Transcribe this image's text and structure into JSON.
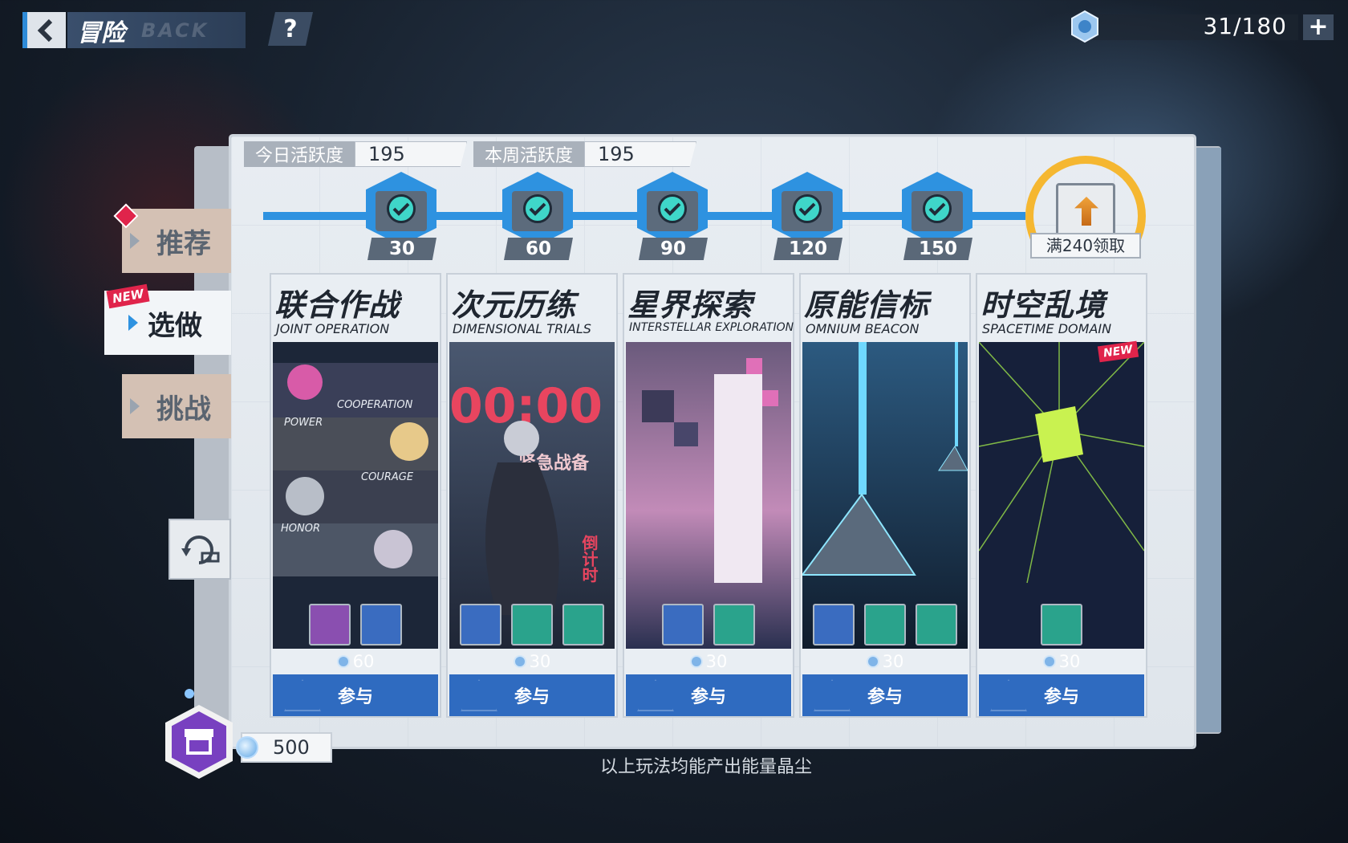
{
  "header": {
    "title": "冒险",
    "title_watermark": "BACK",
    "help_label": "?",
    "stamina": "31/180",
    "plus_label": "+"
  },
  "activity": {
    "today_label": "今日活跃度",
    "today_value": "195",
    "week_label": "本周活跃度",
    "week_value": "195",
    "milestones": [
      "30",
      "60",
      "90",
      "120",
      "150"
    ],
    "final_reward_label": "满240领取"
  },
  "side_tabs": [
    {
      "label": "推荐"
    },
    {
      "label": "选做",
      "badge": "NEW"
    },
    {
      "label": "挑战"
    }
  ],
  "cards": [
    {
      "title": "联合作战",
      "subtitle": "JOINT OPERATION",
      "cost": "60",
      "join": "参与",
      "art_labels": [
        "COOPERATION",
        "POWER",
        "COURAGE",
        "HONOR"
      ]
    },
    {
      "title": "次元历练",
      "subtitle": "DIMENSIONAL TRIALS",
      "cost": "30",
      "join": "参与",
      "art_labels": [
        "00:00",
        "紧急战备",
        "倒计时"
      ]
    },
    {
      "title": "星界探索",
      "subtitle": "INTERSTELLAR EXPLORATION",
      "cost": "30",
      "join": "参与"
    },
    {
      "title": "原能信标",
      "subtitle": "OMNIUM BEACON",
      "cost": "30",
      "join": "参与"
    },
    {
      "title": "时空乱境",
      "subtitle": "SPACETIME DOMAIN",
      "cost": "30",
      "join": "参与",
      "badge": "NEW"
    }
  ],
  "crystal_count": "500",
  "footer": "以上玩法均能产出能量晶尘",
  "colors": {
    "accent": "#2e92e0",
    "join_button": "#2f6bc0",
    "new_badge": "#e0244b",
    "reward_ring": "#f5b731"
  }
}
